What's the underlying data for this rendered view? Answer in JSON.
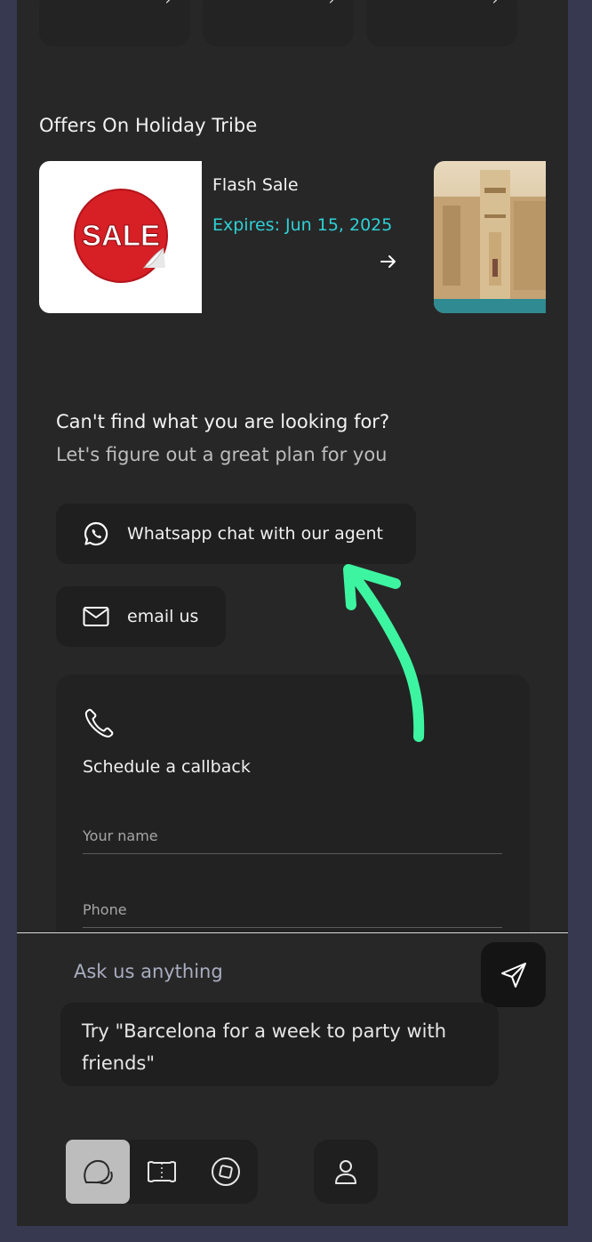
{
  "offers_section": {
    "title": "Offers On Holiday Tribe",
    "offers": [
      {
        "name": "Flash Sale",
        "expiry": "Expires: Jun 15, 2025",
        "badge_text": "SALE"
      }
    ]
  },
  "help_section": {
    "title": "Can't find what you are looking for?",
    "subtitle": "Let's figure out a great plan for you",
    "whatsapp_label": "Whatsapp chat with our agent",
    "email_label": "email us"
  },
  "callback": {
    "title": "Schedule a callback",
    "name_placeholder": "Your name",
    "phone_placeholder": "Phone"
  },
  "chat": {
    "input_placeholder": "Ask us anything",
    "suggestion": "Try \"Barcelona for a week to party with friends\""
  },
  "colors": {
    "accent": "#2ed1d6",
    "annotation": "#3df5a0",
    "background": "#272727"
  },
  "icons": {
    "whatsapp": "whatsapp-icon",
    "email": "envelope-icon",
    "phone": "phone-icon",
    "send": "send-icon",
    "chat": "chat-bubbles-icon",
    "trips": "map-icon",
    "explore": "compass-icon",
    "profile": "user-icon"
  }
}
